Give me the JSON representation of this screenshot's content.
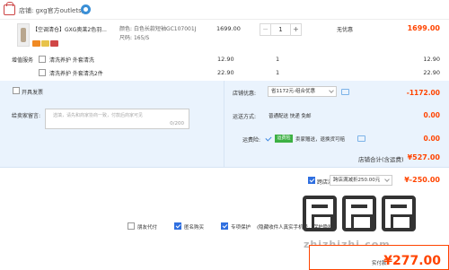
{
  "shop": {
    "label": "店铺:",
    "name": "gxg官方outlets店"
  },
  "item": {
    "title": "【空调清仓】GXG奥莱2色羽...",
    "color_label": "颜色:",
    "color_value": "白色长款短袖GC107001J",
    "size_label": "尺码:",
    "size_value": "165/S",
    "price": "1699.00",
    "quantity": "1",
    "discount": "无优惠",
    "subtotal": "1699.00"
  },
  "services": {
    "title": "增值服务",
    "items": [
      {
        "name": "清洗养护 外套清洗",
        "price": "12.90",
        "qty": "1",
        "subtotal": "12.90"
      },
      {
        "name": "清洗养护 外套清洗2件",
        "price": "22.90",
        "qty": "1",
        "subtotal": "22.90"
      }
    ]
  },
  "invoice": {
    "label": "开具发票"
  },
  "message": {
    "label": "给卖家留言:",
    "placeholder": "选填，请先和商家协商一致，付款后商家可见",
    "count": "0/200"
  },
  "coupon": {
    "label": "店铺优惠:",
    "value": "省1172元-组合优惠",
    "amount": "-1172.00"
  },
  "shipping": {
    "label": "运送方式:",
    "value": "普通配送 快递 免邮",
    "amount": "0.00"
  },
  "insurance": {
    "label": "运费险:",
    "tag": "运费险",
    "desc": "卖家赠送，退换货可赔",
    "amount": "0.00"
  },
  "shop_total": {
    "label": "店铺合计(含运费)",
    "amount": "¥527.00"
  },
  "tmall_points": {
    "label": "跨店满减",
    "select": "跨店满减折250.00元",
    "amount": "¥-250.00"
  },
  "options": [
    {
      "label": "朋友代付",
      "checked": false
    },
    {
      "label": "匿名购买",
      "checked": true
    },
    {
      "label": "专项保护",
      "checked": true
    }
  ],
  "option_extra": "(隐藏收件人真实手机号，保护隐私)",
  "watermark": {
    "text": "zhizhizhi.com"
  },
  "final": {
    "label": "实付款:",
    "amount": "¥277.00"
  },
  "colors": {
    "accent": "#ff4400",
    "blue_bg": "#eaf3fd",
    "check_blue": "#2f6fe0"
  }
}
